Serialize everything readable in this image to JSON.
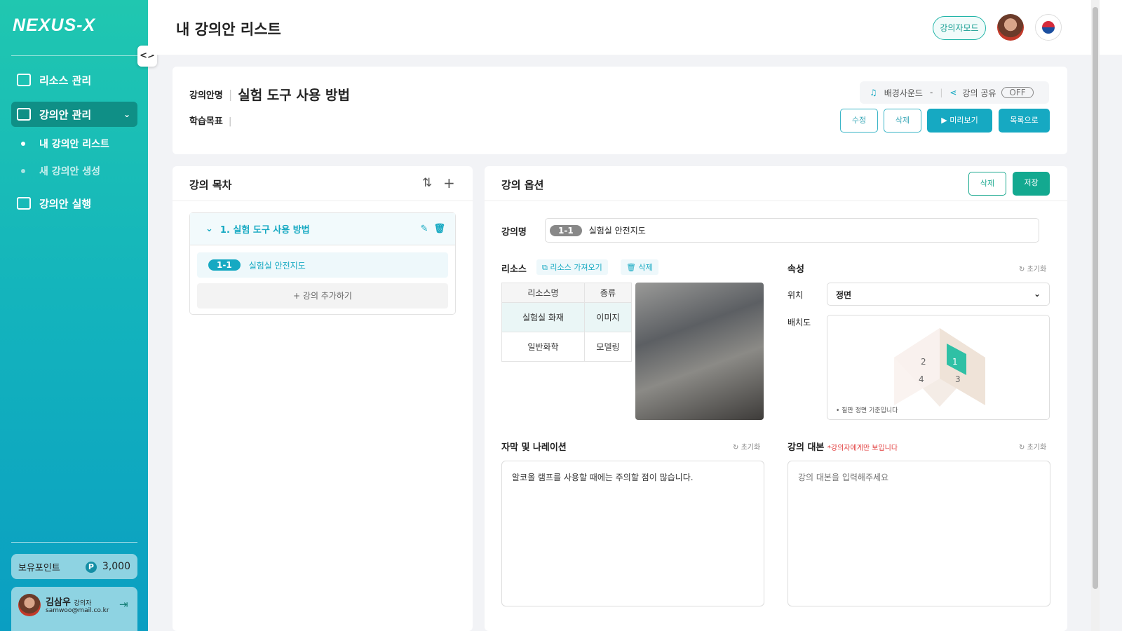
{
  "sidebar": {
    "logo": "NEXUS-X",
    "toggle": "<>",
    "items": [
      {
        "label": "리소스 관리"
      },
      {
        "label": "강의안 관리",
        "chevron": "⌄"
      },
      {
        "label": "강의안 실행"
      }
    ],
    "sub_items": [
      {
        "label": "내 강의안 리스트"
      },
      {
        "label": "새 강의안 생성"
      }
    ],
    "points_label": "보유포인트",
    "points_badge": "P",
    "points_value": "3,000",
    "user_name": "김삼우",
    "user_role": "강의자",
    "user_email": "samwoo@mail.co.kr"
  },
  "header": {
    "title": "내 강의안 리스트",
    "mode_button": "강의자모드"
  },
  "lesson": {
    "name_label": "강의안명",
    "name": "실험 도구 사용 방법",
    "goal_label": "학습목표",
    "bg_sound_label": "배경사운드",
    "bg_sound_value": "-",
    "share_label": "강의 공유",
    "share_state": "OFF",
    "edit": "수정",
    "delete": "삭제",
    "preview": "미리보기",
    "list": "목록으로"
  },
  "toc": {
    "title": "강의 목차",
    "chapter": "1. 실험 도구 사용 방법",
    "item_badge": "1-1",
    "item_label": "실험실 안전지도",
    "add_label": "강의 추가하기"
  },
  "options": {
    "title": "강의 옵션",
    "delete": "삭제",
    "save": "저장",
    "name_label": "강의명",
    "name_badge": "1-1",
    "name_value": "실험실 안전지도",
    "resource_label": "리소스",
    "import": "리소스 가져오기",
    "resource_delete": "삭제",
    "table_headers": [
      "리소스명",
      "종류"
    ],
    "table_rows": [
      [
        "실험실 화재",
        "이미지"
      ],
      [
        "일반화학",
        "모델링"
      ]
    ],
    "attr_label": "속성",
    "reset": "초기화",
    "position_label": "위치",
    "position_value": "정면",
    "layout_label": "배치도",
    "layout_note": "• 칠판 정면 기준입니다",
    "layout_nums": [
      "1",
      "2",
      "3",
      "4"
    ],
    "caption_label": "자막 및 나레이션",
    "caption_value": "알코올 램프를 사용할 때에는 주의할 점이 많습니다.",
    "script_label": "강의 대본",
    "script_note": "*강의자에게만 보입니다",
    "script_placeholder": "강의 대본을 입력해주세요"
  }
}
